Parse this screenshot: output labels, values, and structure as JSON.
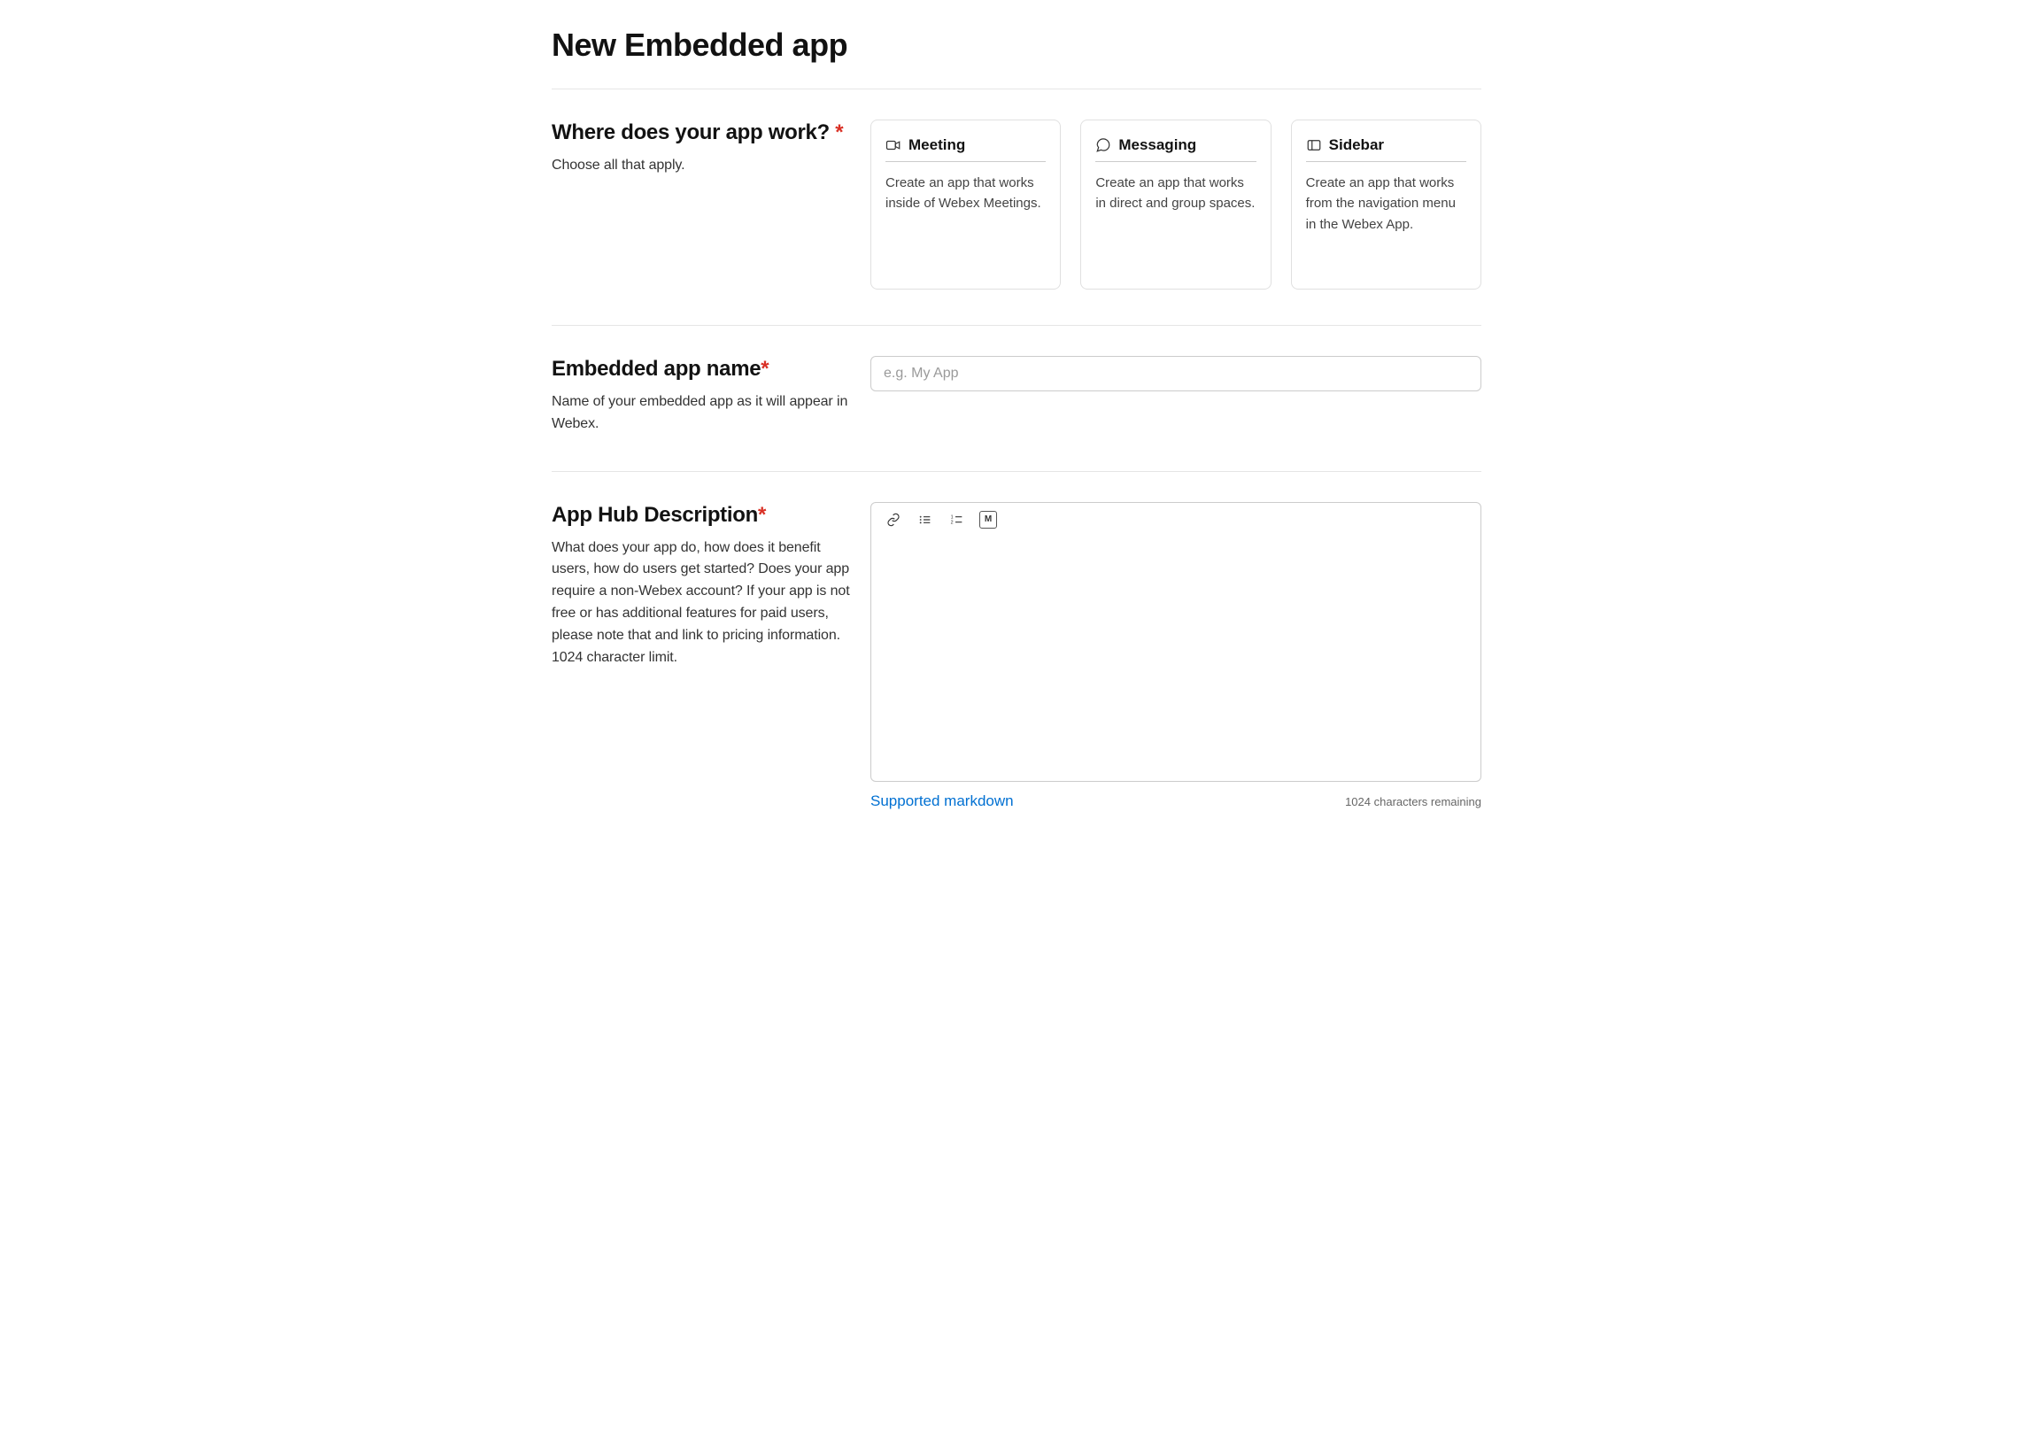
{
  "page": {
    "title": "New Embedded app"
  },
  "where": {
    "heading": "Where does your app work?",
    "required_marker": "*",
    "sub": "Choose all that apply.",
    "cards": [
      {
        "title": "Meeting",
        "desc": "Create an app that works inside of Webex Meetings."
      },
      {
        "title": "Messaging",
        "desc": "Create an app that works in direct and group spaces."
      },
      {
        "title": "Sidebar",
        "desc": "Create an app that works from the navigation menu in the Webex App."
      }
    ]
  },
  "name": {
    "heading": "Embedded app name",
    "required_marker": "*",
    "sub": "Name of your embedded app as it will appear in Webex.",
    "placeholder": "e.g. My App",
    "value": ""
  },
  "description": {
    "heading": "App Hub Description",
    "required_marker": "*",
    "sub": "What does your app do, how does it benefit users, how do users get started? Does your app require a non-Webex account? If your app is not free or has additional features for paid users, please note that and link to pricing information. 1024 character limit.",
    "value": "",
    "markdown_link_label": "Supported markdown",
    "chars_remaining": "1024 characters remaining"
  }
}
